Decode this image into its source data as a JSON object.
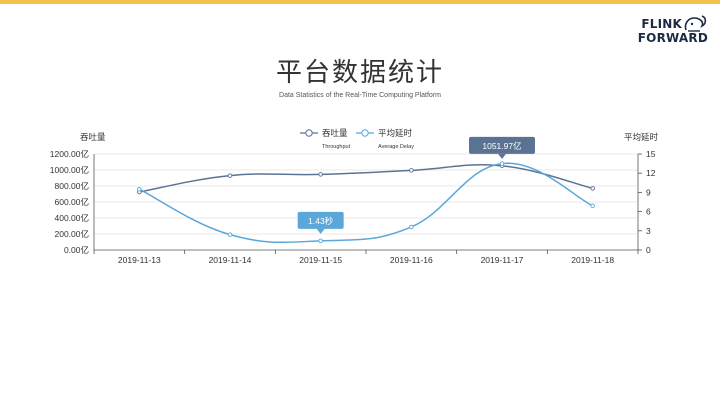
{
  "slide": {
    "title": "平台数据统计",
    "subtitle": "Data Statistics of the Real-Time Computing Platform",
    "accent_color": "#f2c14e"
  },
  "logo": {
    "line1": "FLINK",
    "line2": "FORWARD",
    "icon": "squirrel-icon"
  },
  "chart_data": {
    "type": "line",
    "categories": [
      "2019-11-13",
      "2019-11-14",
      "2019-11-15",
      "2019-11-16",
      "2019-11-17",
      "2019-11-18"
    ],
    "left_axis": {
      "label": "吞吐量",
      "ticks": [
        "0.00亿",
        "200.00亿",
        "400.00亿",
        "600.00亿",
        "800.00亿",
        "1000.00亿",
        "1200.00亿"
      ],
      "ylim": [
        0,
        1200
      ]
    },
    "right_axis": {
      "label": "平均延时",
      "ticks": [
        "0",
        "3",
        "6",
        "9",
        "12",
        "15"
      ],
      "ylim": [
        0,
        15
      ]
    },
    "series": [
      {
        "name": "吞吐量",
        "name_sub": "Throughput",
        "axis": "left",
        "color": "#5b7393",
        "values": [
          725,
          930,
          945,
          995,
          1051.97,
          770
        ]
      },
      {
        "name": "平均延时",
        "name_sub": "Average Delay",
        "axis": "right",
        "color": "#5ba7d9",
        "values": [
          9.5,
          2.4,
          1.43,
          3.6,
          13.5,
          6.9
        ]
      }
    ],
    "annotations": [
      {
        "series": 0,
        "index": 4,
        "text": "1051.97亿",
        "color": "#5b7393"
      },
      {
        "series": 1,
        "index": 2,
        "text": "1.43秒",
        "color": "#5ba7d9"
      }
    ],
    "legend_placement": "top-center",
    "grid": true
  }
}
